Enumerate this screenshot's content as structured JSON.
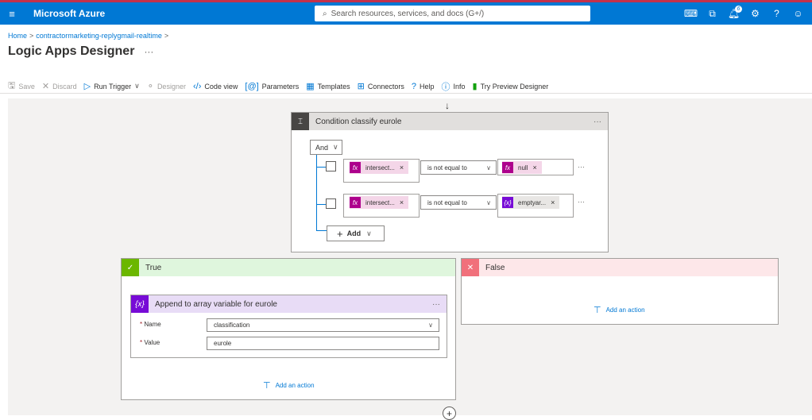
{
  "header": {
    "brand": "Microsoft Azure",
    "search_placeholder": "Search resources, services, and docs (G+/)",
    "notification_count": "6"
  },
  "breadcrumb": {
    "home": "Home",
    "resource": "contractormarketing-replygmail-realtime"
  },
  "page": {
    "title": "Logic Apps Designer",
    "more": "···"
  },
  "toolbar": {
    "save": "Save",
    "discard": "Discard",
    "run_trigger": "Run Trigger",
    "designer": "Designer",
    "code_view": "Code view",
    "parameters": "Parameters",
    "templates": "Templates",
    "connectors": "Connectors",
    "help": "Help",
    "info": "Info",
    "try_preview": "Try Preview Designer"
  },
  "condition": {
    "title": "Condition classify eurole",
    "more": "···",
    "group_operator": "And",
    "rows": [
      {
        "left_token": "intersect...",
        "operator": "is not equal to",
        "right_token": "null"
      },
      {
        "left_token": "intersect...",
        "operator": "is not equal to",
        "right_token": "emptyar..."
      }
    ],
    "add_label": "Add"
  },
  "true_branch": {
    "title": "True",
    "action": {
      "title": "Append to array variable for eurole",
      "more": "···",
      "name_label": "Name",
      "name_value": "classification",
      "value_label": "Value",
      "value_value": "eurole"
    },
    "add_action": "Add an action"
  },
  "false_branch": {
    "title": "False",
    "add_action": "Add an action"
  },
  "icons": {
    "fx": "fx",
    "var": "{x}",
    "remove": "×",
    "required": "*"
  },
  "colors": {
    "azure_blue": "#0078d4",
    "function_token": "#ad008c",
    "variable_token": "#770bd6",
    "true_accent": "#6bb700",
    "false_accent": "#f1707b"
  }
}
